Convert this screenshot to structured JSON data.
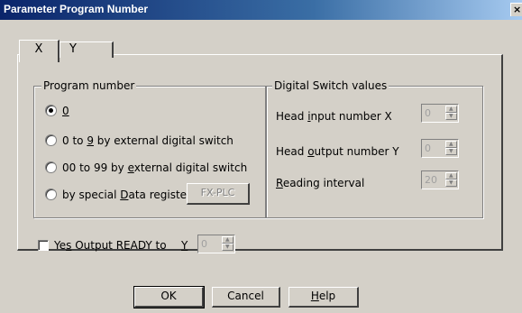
{
  "window": {
    "title": "Parameter Program Number",
    "close_glyph": "×"
  },
  "tabs": [
    {
      "label": "X"
    },
    {
      "label": "Y"
    }
  ],
  "program_group": {
    "title": "Program number",
    "options": [
      {
        "label": "0",
        "selected": true
      },
      {
        "pre": "0 to ",
        "mn": "9",
        "post": " by external digital switch",
        "selected": false
      },
      {
        "pre": "00 to 99 by ",
        "mn": "e",
        "post": "xternal digital switch",
        "selected": false
      },
      {
        "pre": "by special ",
        "mn": "D",
        "post": "ata register",
        "selected": false
      }
    ],
    "fxplc_button": "FX-PLC"
  },
  "digital_group": {
    "title": "Digital Switch values",
    "fields": [
      {
        "pre": "Head ",
        "mn": "i",
        "post": "nput number X",
        "value": "0"
      },
      {
        "pre": "Head ",
        "mn": "o",
        "post": "utput number Y",
        "value": "0"
      },
      {
        "pre": "",
        "mn": "R",
        "post": "eading interval",
        "value": "20"
      }
    ]
  },
  "output_ready": {
    "pre": "Ye",
    "mn": "s",
    "post": " Output READY to",
    "device_label": "Y",
    "value": "0",
    "checked": false
  },
  "buttons": {
    "ok": "OK",
    "cancel": "Cancel",
    "help_mn": "H",
    "help_post": "elp"
  }
}
